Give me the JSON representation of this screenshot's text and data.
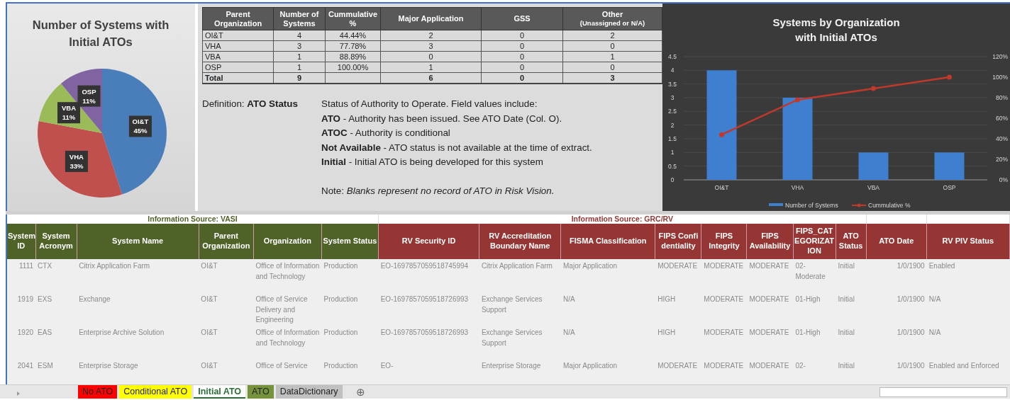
{
  "pie_panel": {
    "chart_data": {
      "type": "pie",
      "title": "Number of Systems with Initial ATOs",
      "categories": [
        "OI&T",
        "VHA",
        "VBA",
        "OSP"
      ],
      "values": [
        45,
        33,
        11,
        11
      ],
      "colors": [
        "#4a7ebb",
        "#c0504d",
        "#9bbb59",
        "#8064a2"
      ],
      "value_labels": [
        "45%",
        "33%",
        "11%",
        "11%"
      ]
    }
  },
  "summary_table": {
    "columns": [
      {
        "label": "Parent Organization"
      },
      {
        "label": "Number of Systems"
      },
      {
        "label": "Cummulative %"
      },
      {
        "label": "Major Application"
      },
      {
        "label": "GSS"
      },
      {
        "label": "Other",
        "note": "(Unassigned or N/A)"
      }
    ],
    "rows": [
      [
        "OI&T",
        "4",
        "44.44%",
        "2",
        "0",
        "2"
      ],
      [
        "VHA",
        "3",
        "77.78%",
        "3",
        "0",
        "0"
      ],
      [
        "VBA",
        "1",
        "88.89%",
        "0",
        "0",
        "1"
      ],
      [
        "OSP",
        "1",
        "100.00%",
        "1",
        "0",
        "0"
      ]
    ],
    "total": {
      "label": "Total",
      "systems": "9",
      "major_application": "6",
      "gss": "0",
      "other": "3"
    }
  },
  "definition": {
    "label": "Definition:  **ATO Status**",
    "lines": [
      "Status of Authority to Operate. Field values include:",
      "**ATO** - Authority has been issued. See ATO Date (Col. O).",
      "**ATOC** - Authority is conditional",
      "**Not Available** - ATO status is not available at the time of extract.",
      "**Initial** - Initial ATO is being developed for this system"
    ],
    "note": "Note: *Blanks represent no record of ATO in Risk Vision.*"
  },
  "bar_panel": {
    "chart_data": {
      "type": "bar",
      "title": "Systems by Organization with Initial ATOs",
      "categories": [
        "OI&T",
        "VHA",
        "VBA",
        "OSP"
      ],
      "series": [
        {
          "name": "Number of Systems",
          "color": "#3f7fd0",
          "type": "bar",
          "values": [
            4,
            3,
            1,
            1
          ]
        },
        {
          "name": "Cummulative %",
          "color": "#c0392b",
          "type": "line",
          "axis": "y2",
          "marker": "circle",
          "values": [
            0.44,
            0.78,
            0.89,
            1.0
          ]
        }
      ],
      "grid": true,
      "legend": true,
      "ylim": [
        0,
        4.5
      ],
      "yticks": [
        {
          "value": 0,
          "label": "0"
        },
        {
          "value": 0.5,
          "label": "0.5"
        },
        {
          "value": 1,
          "label": "1"
        },
        {
          "value": 1.5,
          "label": "1.5"
        },
        {
          "value": 2,
          "label": "2"
        },
        {
          "value": 2.5,
          "label": "2.5"
        },
        {
          "value": 3,
          "label": "3"
        },
        {
          "value": 3.5,
          "label": "3.5"
        },
        {
          "value": 4,
          "label": "4"
        },
        {
          "value": 4.5,
          "label": "4.5"
        }
      ],
      "y2lim": [
        0,
        1.2
      ],
      "y2ticks": [
        {
          "value": 0,
          "label": "0%"
        },
        {
          "value": 0.2,
          "label": "20%"
        },
        {
          "value": 0.4,
          "label": "40%"
        },
        {
          "value": 0.6,
          "label": "60%"
        },
        {
          "value": 0.8,
          "label": "80%"
        },
        {
          "value": 1,
          "label": "100%"
        },
        {
          "value": 1.2,
          "label": "120%"
        }
      ]
    }
  },
  "sheet": {
    "bands": [
      {
        "label": "Information Source: VASI",
        "kind": "vasi",
        "columns": [
          "System ID",
          "System Acronym",
          "System Name",
          "Parent Organization",
          "Organization",
          "System Status"
        ]
      },
      {
        "label": "Information Source: GRC/RV",
        "kind": "rv",
        "columns": [
          "RV Security ID",
          "RV Accreditation Boundary Name",
          "FISMA Classification",
          "FIPS Confidentiality",
          "FIPS Integrity",
          "FIPS Availability",
          "FIPS_CATEGORIZATION",
          "ATO Status"
        ]
      },
      {
        "kind": "rv",
        "columns": [
          "ATO Date",
          "RV PIV Status"
        ]
      }
    ],
    "rows": [
      [
        "1111",
        "CTX",
        "Citrix Application Farm",
        "OI&T",
        "Office of Information and Technology",
        "Production",
        "EO-1697857059518745994",
        "Citrix Application Farm",
        "Major Application",
        "MODERATE",
        "MODERATE",
        "MODERATE",
        "02-Moderate",
        "Initial",
        "1/0/1900",
        "Enabled"
      ],
      [
        "1919",
        "EXS",
        "Exchange",
        "OI&T",
        "Office of Service Delivery and Engineering",
        "Production",
        "EO-1697857059518726993",
        "Exchange Services Support",
        "N/A",
        "HIGH",
        "MODERATE",
        "MODERATE",
        "01-High",
        "Initial",
        "1/0/1900",
        "N/A"
      ],
      [
        "1920",
        "EAS",
        "Enterprise Archive Solution",
        "OI&T",
        "Office of Information and Technology",
        "Production",
        "EO-1697857059518726993",
        "Exchange Services Support",
        "N/A",
        "HIGH",
        "MODERATE",
        "MODERATE",
        "01-High",
        "Initial",
        "1/0/1900",
        "N/A"
      ],
      [
        "2041",
        "ESM",
        "Enterprise Storage",
        "OI&T",
        "Office of Service",
        "Production",
        "EO-",
        "Enterprise Storage",
        "Major Application",
        "MODERATE",
        "MODERATE",
        "MODERATE",
        "02-",
        "Initial",
        "1/0/1900",
        "Enabled and Enforced"
      ]
    ]
  },
  "sheet_tabs": [
    {
      "label": "No ATO",
      "color": "#ff0000",
      "selected": false
    },
    {
      "label": "Conditional ATO",
      "color": "#ffff00",
      "selected": false
    },
    {
      "label": "Initial ATO",
      "color": "#ffffff",
      "selected": true
    },
    {
      "label": "ATO",
      "color": "#76933c",
      "selected": false
    },
    {
      "label": "DataDictionary",
      "color": "#c0c0c0",
      "selected": false
    }
  ],
  "add_sheet": "⊕"
}
